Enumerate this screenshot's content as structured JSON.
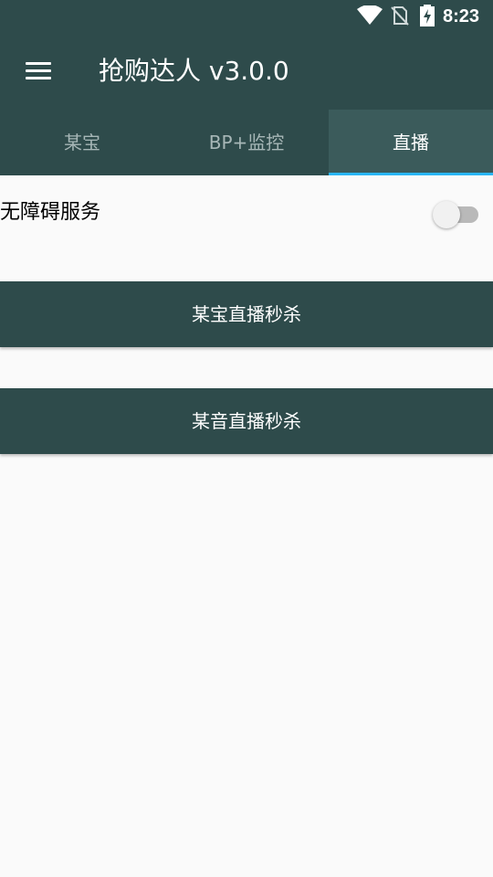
{
  "status_bar": {
    "time": "8:23",
    "icons": [
      "wifi-icon",
      "no-sim-icon",
      "battery-charging-icon"
    ]
  },
  "toolbar": {
    "menu_icon": "hamburger-menu-icon",
    "title": "抢购达人 v3.0.0"
  },
  "tabs": [
    {
      "label": "某宝",
      "active": false
    },
    {
      "label": "BP+监控",
      "active": false
    },
    {
      "label": "直播",
      "active": true
    }
  ],
  "accessibility": {
    "label": "无障碍服务",
    "enabled": false
  },
  "buttons": {
    "taobao_live": "某宝直播秒杀",
    "douyin_live": "某音直播秒杀"
  },
  "colors": {
    "primary": "#2e4b4b",
    "tab_active_bg": "#3b5b5b",
    "tab_indicator": "#29b6f6",
    "background": "#fafafa"
  }
}
